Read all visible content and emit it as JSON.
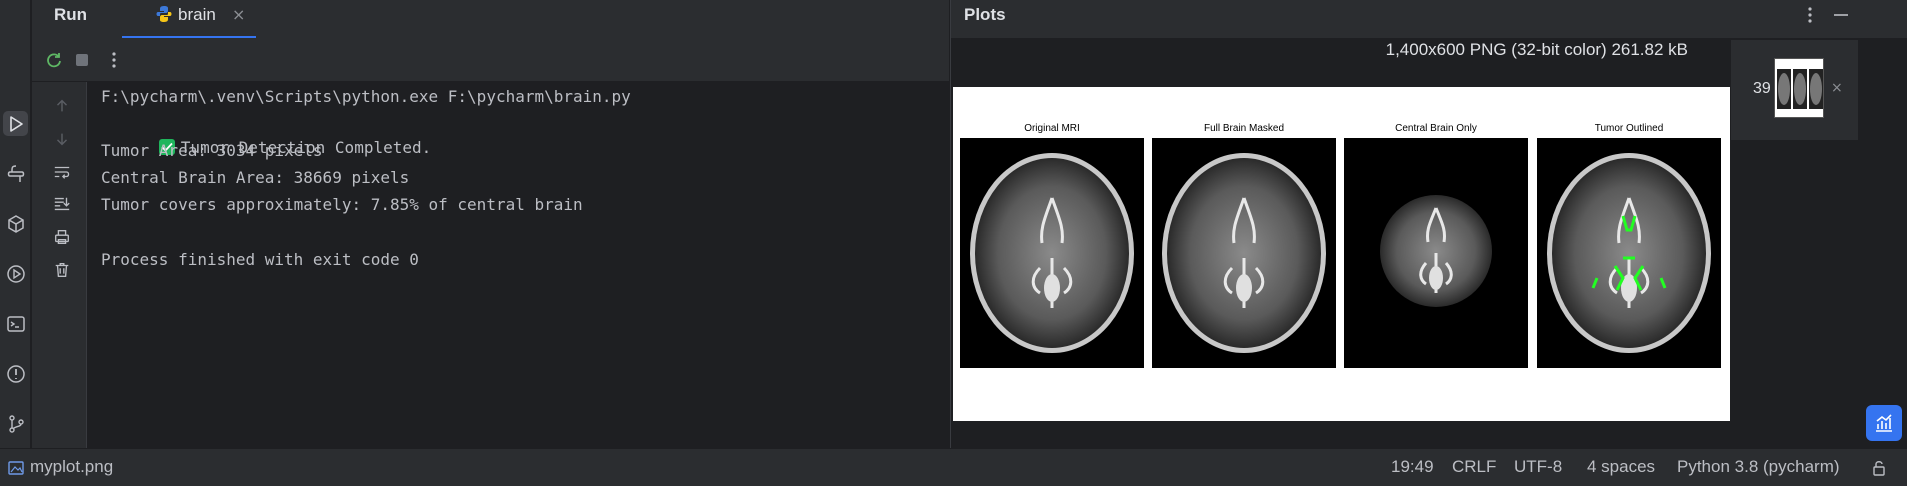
{
  "run": {
    "title": "Run",
    "tab_label": "brain",
    "tab_close": "×"
  },
  "console": {
    "lines": [
      "F:\\pycharm\\.venv\\Scripts\\python.exe F:\\pycharm\\brain.py",
      "Tumor Detection Completed.",
      "Tumor Area: 3034 pixels",
      "Central Brain Area: 38669 pixels",
      "Tumor covers approximately: 7.85% of central brain",
      "",
      "Process finished with exit code 0"
    ]
  },
  "plots": {
    "title": "Plots",
    "image_info": "1,400x600 PNG (32-bit color) 261.82 kB",
    "subplots": [
      "Original MRI",
      "Full Brain Masked",
      "Central Brain Only",
      "Tumor Outlined"
    ],
    "thumbnail_count": "39",
    "thumbnail_close": "×"
  },
  "status": {
    "file": "myplot.png",
    "position": "19:49",
    "line_ending": "CRLF",
    "encoding": "UTF-8",
    "indent": "4 spaces",
    "interpreter": "Python 3.8 (pycharm)"
  },
  "colors": {
    "accent": "#3574f0",
    "success": "#1fb55c",
    "tumor_outline": "#22ff22"
  }
}
